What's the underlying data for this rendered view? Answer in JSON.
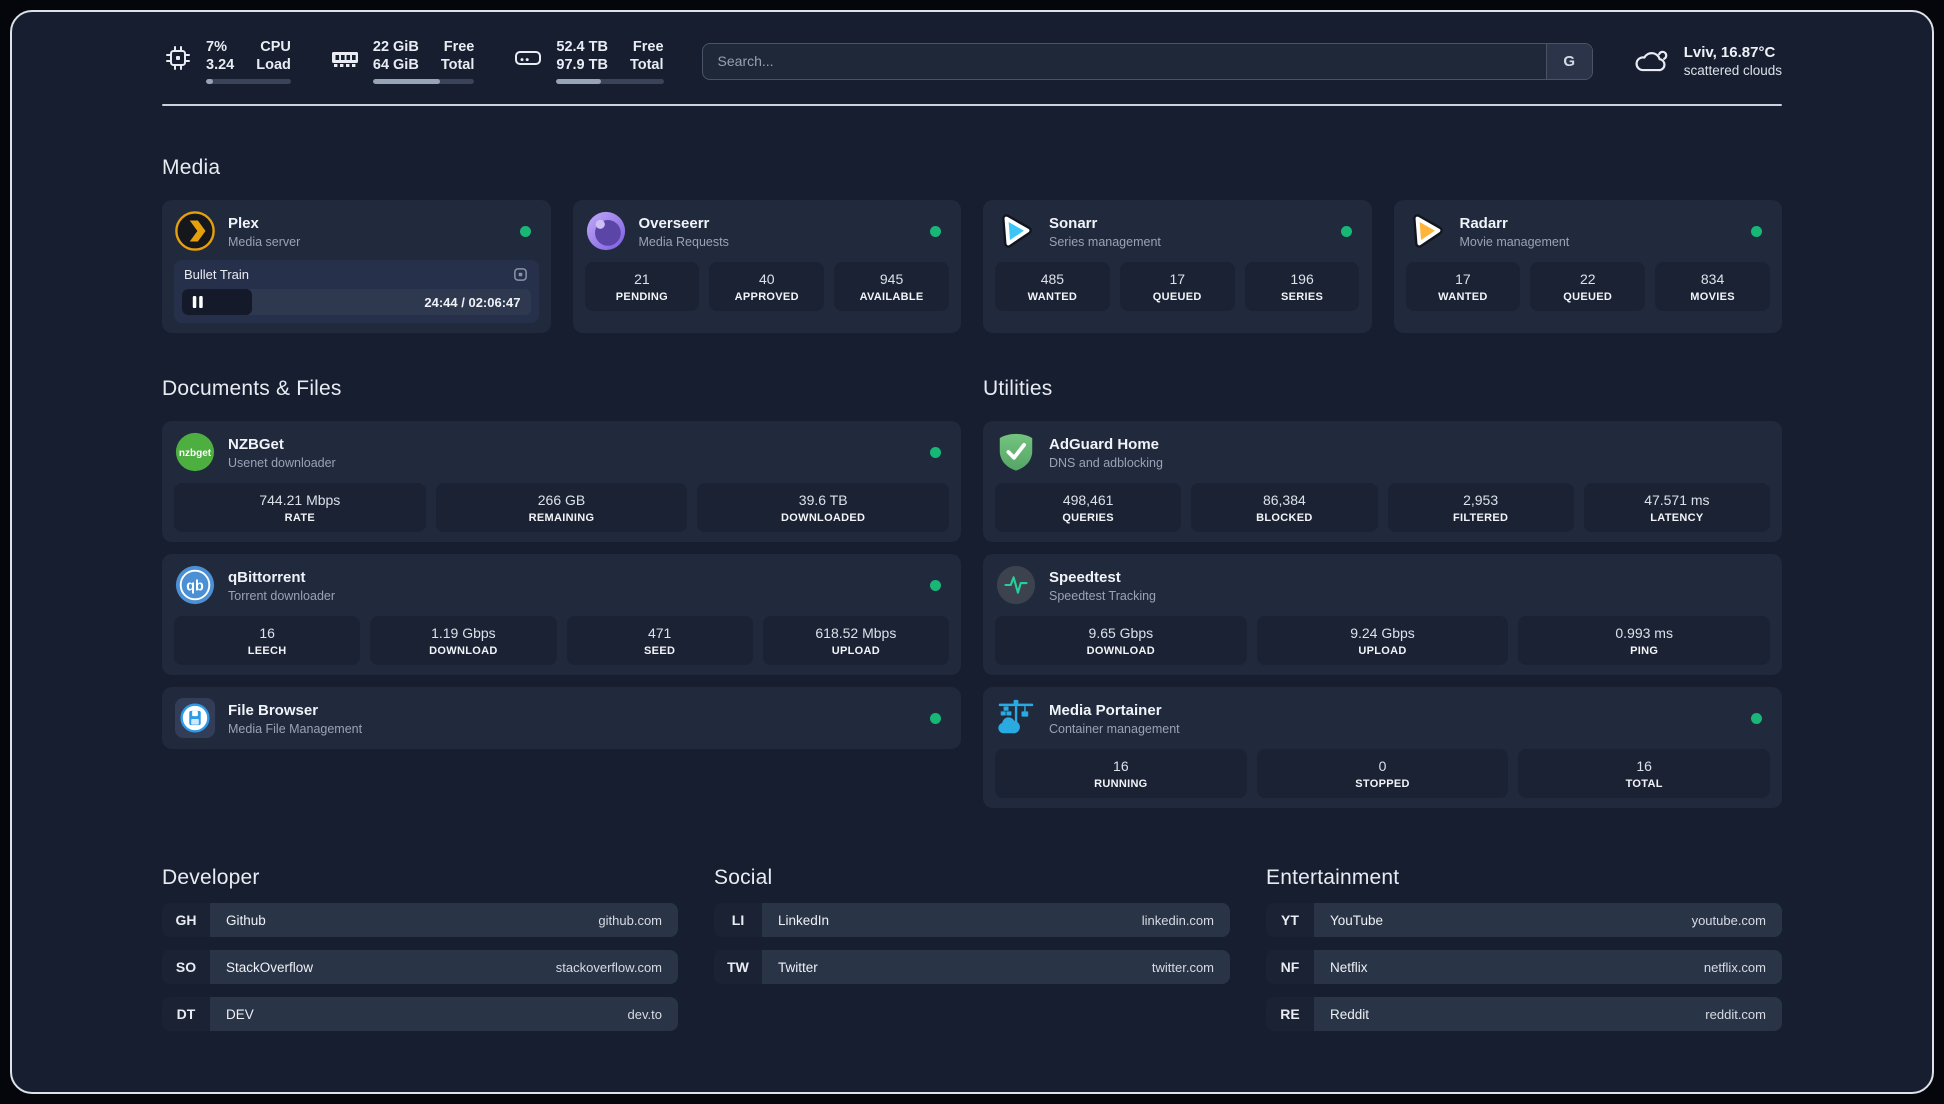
{
  "header": {
    "stats": [
      {
        "icon": "cpu-icon",
        "value_top": "7%",
        "value_bottom": "3.24",
        "label_top": "CPU",
        "label_bottom": "Load",
        "progress_pct": 8
      },
      {
        "icon": "memory-icon",
        "value_top": "22 GiB",
        "value_bottom": "64 GiB",
        "label_top": "Free",
        "label_bottom": "Total",
        "progress_pct": 66
      },
      {
        "icon": "disk-icon",
        "value_top": "52.4 TB",
        "value_bottom": "97.9 TB",
        "label_top": "Free",
        "label_bottom": "Total",
        "progress_pct": 42
      }
    ],
    "search": {
      "placeholder": "Search...",
      "button_label": "G"
    },
    "weather": {
      "icon": "cloud-icon",
      "location": "Lviv, 16.87°C",
      "condition": "scattered clouds"
    }
  },
  "sections": {
    "media": {
      "title": "Media",
      "apps": [
        {
          "icon": "plex-icon",
          "name": "Plex",
          "subtitle": "Media server",
          "status": "online",
          "player": {
            "title": "Bullet Train",
            "time_display": "24:44 / 02:06:47",
            "progress_pct": 20
          }
        },
        {
          "icon": "overseerr-icon",
          "name": "Overseerr",
          "subtitle": "Media Requests",
          "status": "online",
          "stats": [
            {
              "value": "21",
              "label": "PENDING"
            },
            {
              "value": "40",
              "label": "APPROVED"
            },
            {
              "value": "945",
              "label": "AVAILABLE"
            }
          ]
        },
        {
          "icon": "sonarr-icon",
          "name": "Sonarr",
          "subtitle": "Series management",
          "status": "online",
          "stats": [
            {
              "value": "485",
              "label": "WANTED"
            },
            {
              "value": "17",
              "label": "QUEUED"
            },
            {
              "value": "196",
              "label": "SERIES"
            }
          ]
        },
        {
          "icon": "radarr-icon",
          "name": "Radarr",
          "subtitle": "Movie management",
          "status": "online",
          "stats": [
            {
              "value": "17",
              "label": "WANTED"
            },
            {
              "value": "22",
              "label": "QUEUED"
            },
            {
              "value": "834",
              "label": "MOVIES"
            }
          ]
        }
      ]
    },
    "documents": {
      "title": "Documents & Files",
      "apps": [
        {
          "icon": "nzbget-icon",
          "name": "NZBGet",
          "subtitle": "Usenet downloader",
          "status": "online",
          "stats": [
            {
              "value": "744.21 Mbps",
              "label": "RATE"
            },
            {
              "value": "266 GB",
              "label": "REMAINING"
            },
            {
              "value": "39.6 TB",
              "label": "DOWNLOADED"
            }
          ]
        },
        {
          "icon": "qbittorrent-icon",
          "name": "qBittorrent",
          "subtitle": "Torrent downloader",
          "status": "online",
          "stats": [
            {
              "value": "16",
              "label": "LEECH"
            },
            {
              "value": "1.19 Gbps",
              "label": "DOWNLOAD"
            },
            {
              "value": "471",
              "label": "SEED"
            },
            {
              "value": "618.52 Mbps",
              "label": "UPLOAD"
            }
          ]
        },
        {
          "icon": "filebrowser-icon",
          "name": "File Browser",
          "subtitle": "Media File Management",
          "status": "online",
          "stats": []
        }
      ]
    },
    "utilities": {
      "title": "Utilities",
      "apps": [
        {
          "icon": "adguard-icon",
          "name": "AdGuard Home",
          "subtitle": "DNS and adblocking",
          "stats": [
            {
              "value": "498,461",
              "label": "QUERIES"
            },
            {
              "value": "86,384",
              "label": "BLOCKED"
            },
            {
              "value": "2,953",
              "label": "FILTERED"
            },
            {
              "value": "47.571 ms",
              "label": "LATENCY"
            }
          ]
        },
        {
          "icon": "speedtest-icon",
          "name": "Speedtest",
          "subtitle": "Speedtest Tracking",
          "stats": [
            {
              "value": "9.65 Gbps",
              "label": "DOWNLOAD"
            },
            {
              "value": "9.24 Gbps",
              "label": "UPLOAD"
            },
            {
              "value": "0.993 ms",
              "label": "PING"
            }
          ]
        },
        {
          "icon": "portainer-icon",
          "name": "Media Portainer",
          "subtitle": "Container management",
          "status": "online",
          "stats": [
            {
              "value": "16",
              "label": "RUNNING"
            },
            {
              "value": "0",
              "label": "STOPPED"
            },
            {
              "value": "16",
              "label": "TOTAL"
            }
          ]
        }
      ]
    },
    "bookmarks": [
      {
        "title": "Developer",
        "links": [
          {
            "abbr": "GH",
            "name": "Github",
            "url": "github.com"
          },
          {
            "abbr": "SO",
            "name": "StackOverflow",
            "url": "stackoverflow.com"
          },
          {
            "abbr": "DT",
            "name": "DEV",
            "url": "dev.to"
          }
        ]
      },
      {
        "title": "Social",
        "links": [
          {
            "abbr": "LI",
            "name": "LinkedIn",
            "url": "linkedin.com"
          },
          {
            "abbr": "TW",
            "name": "Twitter",
            "url": "twitter.com"
          }
        ]
      },
      {
        "title": "Entertainment",
        "links": [
          {
            "abbr": "YT",
            "name": "YouTube",
            "url": "youtube.com"
          },
          {
            "abbr": "NF",
            "name": "Netflix",
            "url": "netflix.com"
          },
          {
            "abbr": "RE",
            "name": "Reddit",
            "url": "reddit.com"
          }
        ]
      }
    ]
  },
  "colors": {
    "background": "#161e30",
    "card": "#212a3c",
    "tile": "#1a2233",
    "status_online": "#17b877",
    "plex_amber": "#e5a00d",
    "sonarr_blue": "#3dc5f3",
    "radarr_yellow": "#ffb53c",
    "nzbget_green": "#4caf3f",
    "qbittorrent_blue": "#4b8fd4",
    "adguard_green": "#5fae6c",
    "speedtest_green": "#26d09c",
    "portainer_blue": "#29abe2",
    "filebrowser_blue": "#2e9be8"
  }
}
